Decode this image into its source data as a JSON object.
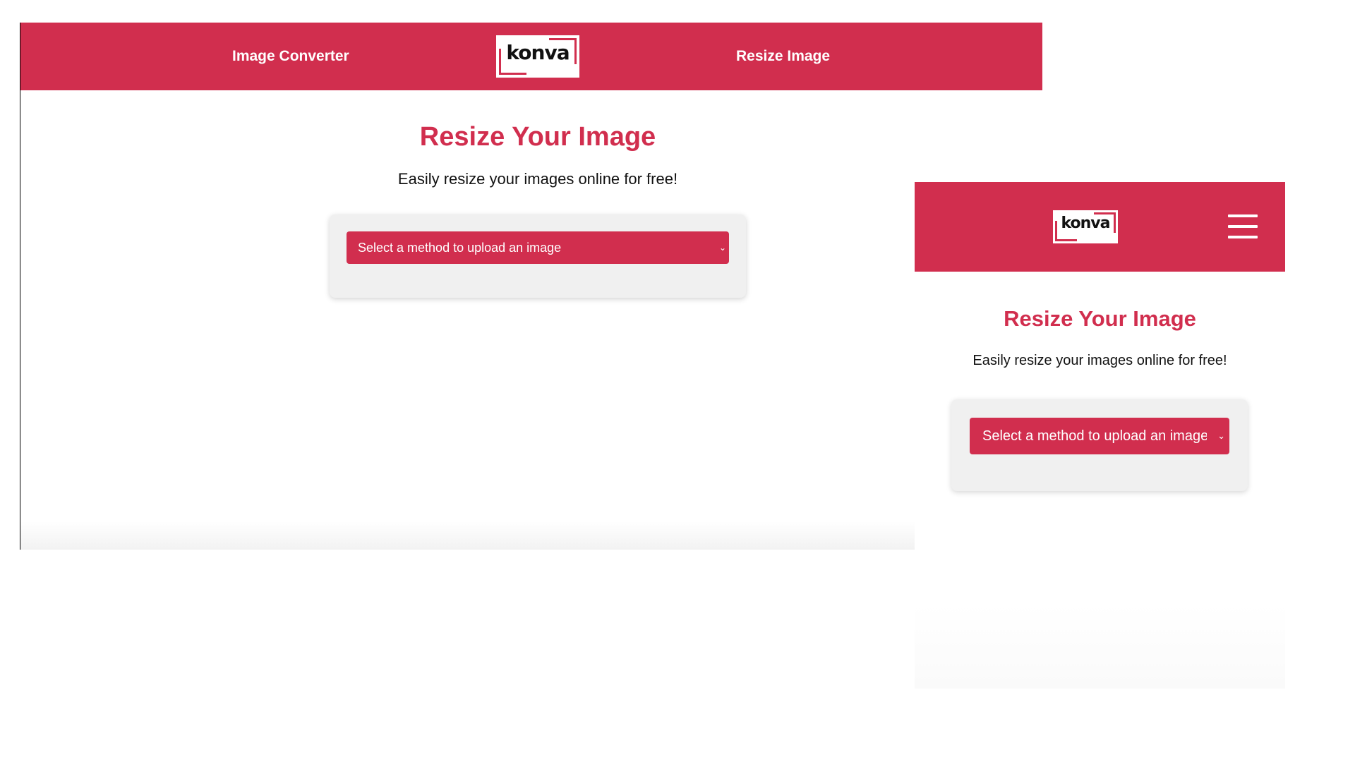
{
  "brand": {
    "logo_text": "konva",
    "primary_color": "#d12e4e"
  },
  "desktop": {
    "nav": {
      "left_link": "Image Converter",
      "right_link": "Resize Image"
    },
    "title": "Resize Your Image",
    "subtitle": "Easily resize your images online for free!",
    "upload_select": {
      "selected": "Select a method to upload an image",
      "chevron_icon": "chevron-down-icon"
    }
  },
  "mobile": {
    "menu_icon": "hamburger-menu-icon",
    "title": "Resize Your Image",
    "subtitle": "Easily resize your images online for free!",
    "upload_select": {
      "selected": "Select a method to upload an image",
      "chevron_icon": "chevron-down-icon"
    }
  }
}
